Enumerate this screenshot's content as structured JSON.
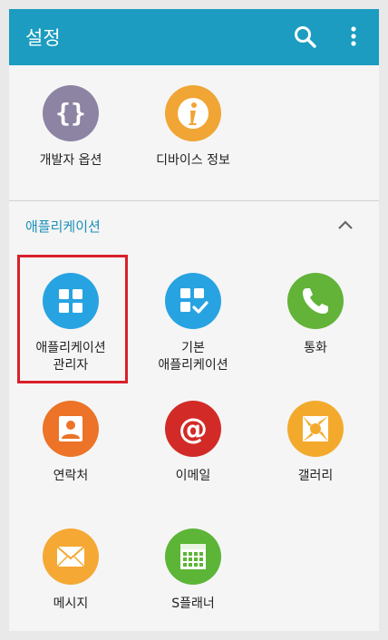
{
  "app_bar": {
    "title": "설정",
    "actions": [
      {
        "icon": "search-icon"
      },
      {
        "icon": "more-vert-icon"
      }
    ],
    "color": "#1b9cc0"
  },
  "top_items": [
    {
      "label": "개발자 옵션",
      "icon": "braces-icon",
      "color": "#8d83a3"
    },
    {
      "label": "디바이스 정보",
      "icon": "info-icon",
      "color": "#f0a534"
    }
  ],
  "section": {
    "title": "애플리케이션",
    "collapse_icon": "chevron-up-icon",
    "items": [
      {
        "label": "애플리케이션\n관리자",
        "icon": "grid-icon",
        "color": "#28a3e2",
        "highlighted": true
      },
      {
        "label": "기본\n애플리케이션",
        "icon": "grid-check-icon",
        "color": "#28a3e2"
      },
      {
        "label": "통화",
        "icon": "phone-icon",
        "color": "#62b338"
      },
      {
        "label": "연락처",
        "icon": "contact-icon",
        "color": "#ec7327"
      },
      {
        "label": "이메일",
        "icon": "at-icon",
        "color": "#d22b27"
      },
      {
        "label": "갤러리",
        "icon": "gallery-icon",
        "color": "#f3aa2c"
      },
      {
        "label": "메시지",
        "icon": "message-icon",
        "color": "#f5a833"
      },
      {
        "label": "S플래너",
        "icon": "calendar-icon",
        "color": "#5cb536"
      }
    ]
  },
  "highlight_color": "#d9202a"
}
